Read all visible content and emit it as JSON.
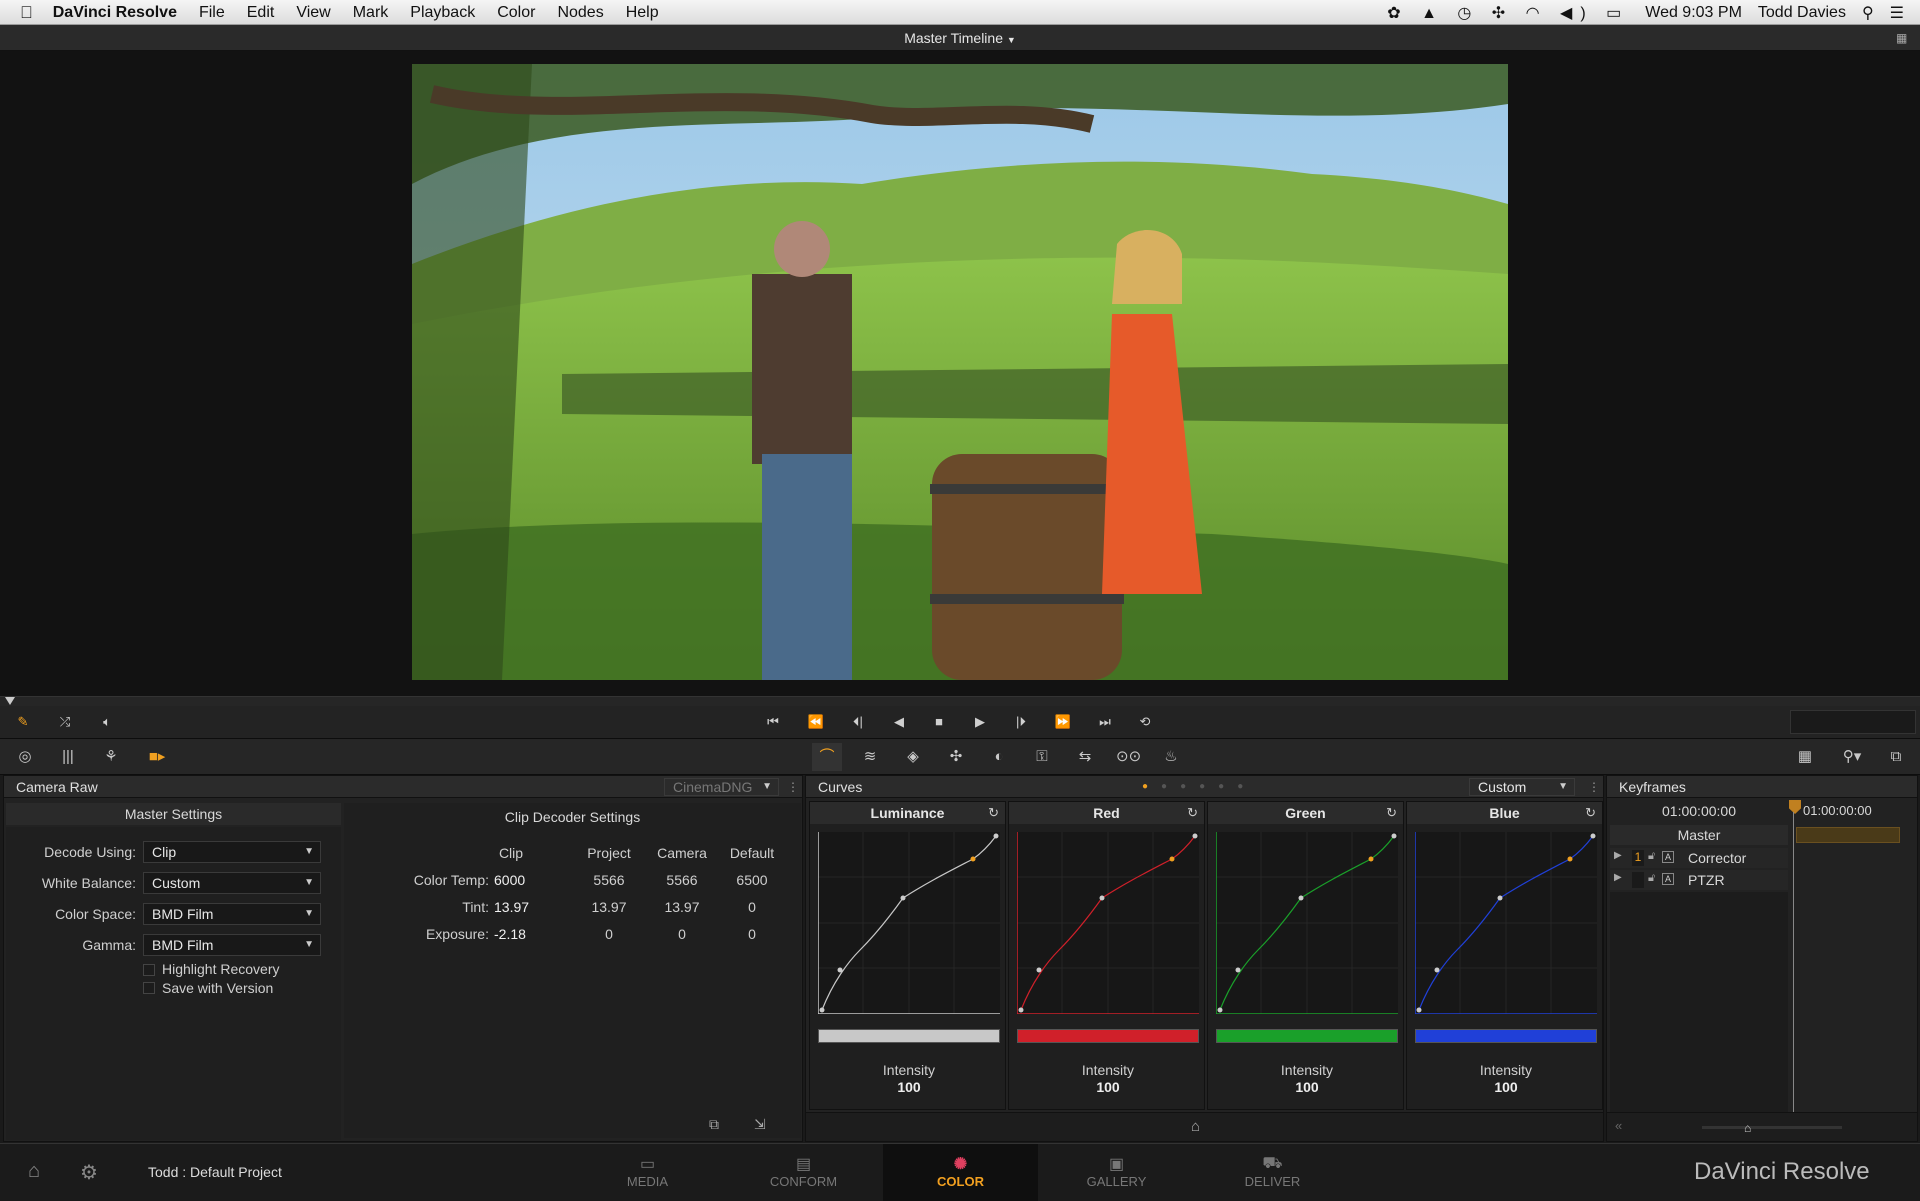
{
  "menubar": {
    "apple": "",
    "app_name": "DaVinci Resolve",
    "menus": [
      "File",
      "Edit",
      "View",
      "Mark",
      "Playback",
      "Color",
      "Nodes",
      "Help"
    ],
    "clock": "Wed 9:03 PM",
    "user": "Todd Davies"
  },
  "viewer": {
    "timeline_title": "Master Timeline"
  },
  "camera_raw": {
    "panel_title": "Camera Raw",
    "format_select": "CinemaDNG",
    "master_settings_title": "Master Settings",
    "fields": [
      {
        "label": "Decode Using:",
        "value": "Clip"
      },
      {
        "label": "White Balance:",
        "value": "Custom"
      },
      {
        "label": "Color Space:",
        "value": "BMD Film"
      },
      {
        "label": "Gamma:",
        "value": "BMD Film"
      }
    ],
    "checkboxes": [
      "Highlight Recovery",
      "Save with Version"
    ],
    "clip_decoder_title": "Clip Decoder Settings",
    "columns": [
      "Clip",
      "Project",
      "Camera",
      "Default"
    ],
    "rows": [
      {
        "label": "Color Temp:",
        "clip": "6000",
        "project": "5566",
        "camera": "5566",
        "default": "6500"
      },
      {
        "label": "Tint:",
        "clip": "13.97",
        "project": "13.97",
        "camera": "13.97",
        "default": "0"
      },
      {
        "label": "Exposure:",
        "clip": "-2.18",
        "project": "0",
        "camera": "0",
        "default": "0"
      }
    ]
  },
  "curves": {
    "panel_title": "Curves",
    "mode": "Custom",
    "channels": [
      {
        "name": "Luminance",
        "color": "#c8c8c8",
        "intensity_label": "Intensity",
        "intensity": "100"
      },
      {
        "name": "Red",
        "color": "#d0202a",
        "intensity_label": "Intensity",
        "intensity": "100"
      },
      {
        "name": "Green",
        "color": "#1aa02a",
        "intensity_label": "Intensity",
        "intensity": "100"
      },
      {
        "name": "Blue",
        "color": "#2040d8",
        "intensity_label": "Intensity",
        "intensity": "100"
      }
    ]
  },
  "keyframes": {
    "panel_title": "Keyframes",
    "timecode_left": "01:00:00:00",
    "timecode_right": "01:00:00:00",
    "master_label": "Master",
    "tracks": [
      {
        "num": "1",
        "name": "Corrector"
      },
      {
        "num": "",
        "name": "PTZR"
      }
    ]
  },
  "bottom": {
    "project": "Todd : Default Project",
    "pages": [
      "MEDIA",
      "CONFORM",
      "COLOR",
      "GALLERY",
      "DELIVER"
    ],
    "active_page": "COLOR",
    "brand": "DaVinci Resolve"
  },
  "colors": {
    "accent": "#e8a020",
    "active_page": "#f2a020"
  }
}
